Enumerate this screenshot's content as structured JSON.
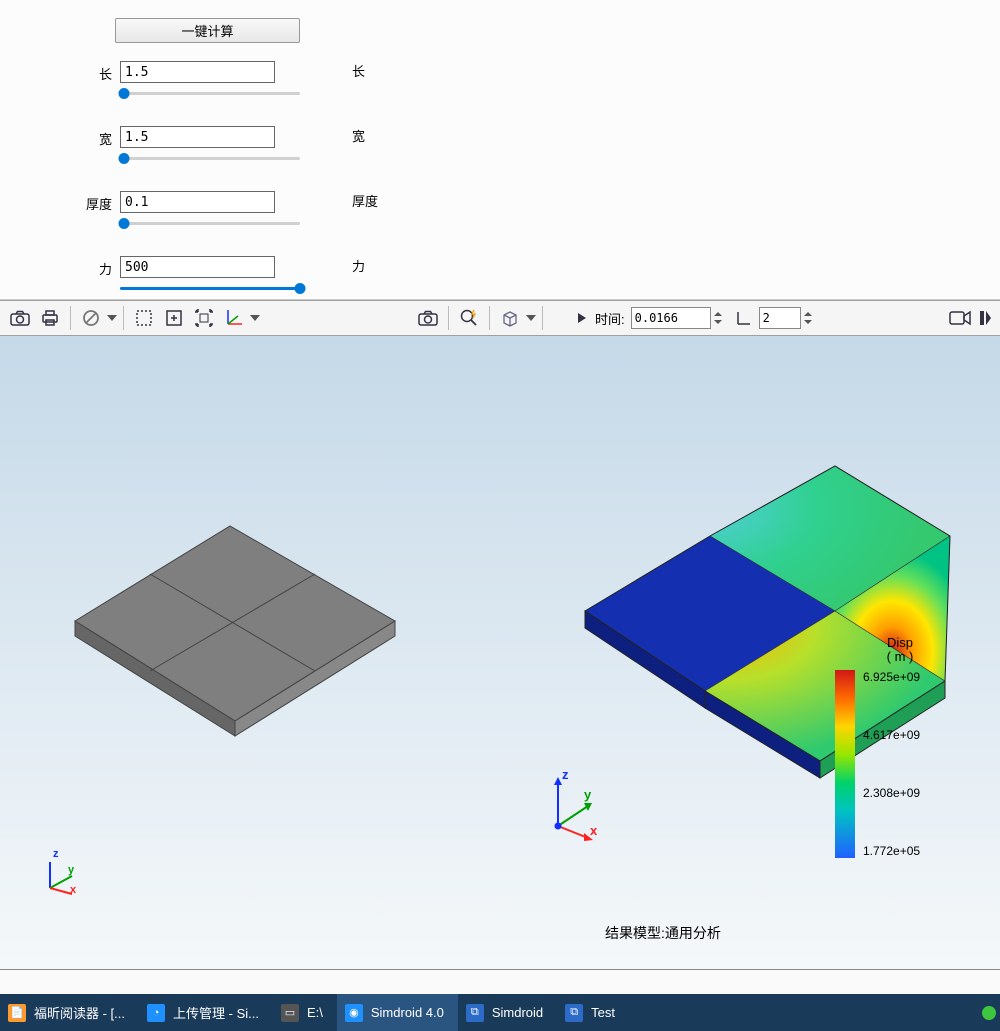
{
  "calc_button": "一键计算",
  "params": {
    "length": {
      "label": "长",
      "value": "1.5",
      "right": "长",
      "pos": 2
    },
    "width": {
      "label": "宽",
      "value": "1.5",
      "right": "宽",
      "pos": 2
    },
    "thick": {
      "label": "厚度",
      "value": "0.1",
      "right": "厚度",
      "pos": 2
    },
    "force": {
      "label": "力",
      "value": "500",
      "right": "力",
      "pos": 100
    }
  },
  "time": {
    "label": "时间:",
    "value": "0.0166",
    "count": "2"
  },
  "legend": {
    "title1": "Disp",
    "title2": "( m )",
    "ticks": [
      "6.925e+09",
      "4.617e+09",
      "2.308e+09",
      "1.772e+05"
    ]
  },
  "result_label": "结果模型:通用分析",
  "taskbar": [
    {
      "label": "福昕阅读器 - [...",
      "icon": "📄",
      "bg": "#ff9a2e"
    },
    {
      "label": "上传管理 - Si...",
      "icon": "◔",
      "bg": "#1e90ff"
    },
    {
      "label": "E:\\",
      "icon": "▭",
      "bg": "#888"
    },
    {
      "label": "Simdroid 4.0",
      "icon": "◉",
      "bg": "#1e90ff"
    },
    {
      "label": "Simdroid",
      "icon": "⧉",
      "bg": "#2c6cc8"
    },
    {
      "label": "Test",
      "icon": "⧉",
      "bg": "#2c6cc8"
    }
  ],
  "chart_data": {
    "type": "heatmap",
    "title": "Disp (m)",
    "colormap": "jet",
    "range": [
      177200.0,
      6925000000.0
    ],
    "ticks": [
      6925000000.0,
      4617000000.0,
      2308000000.0,
      177200.0
    ]
  }
}
